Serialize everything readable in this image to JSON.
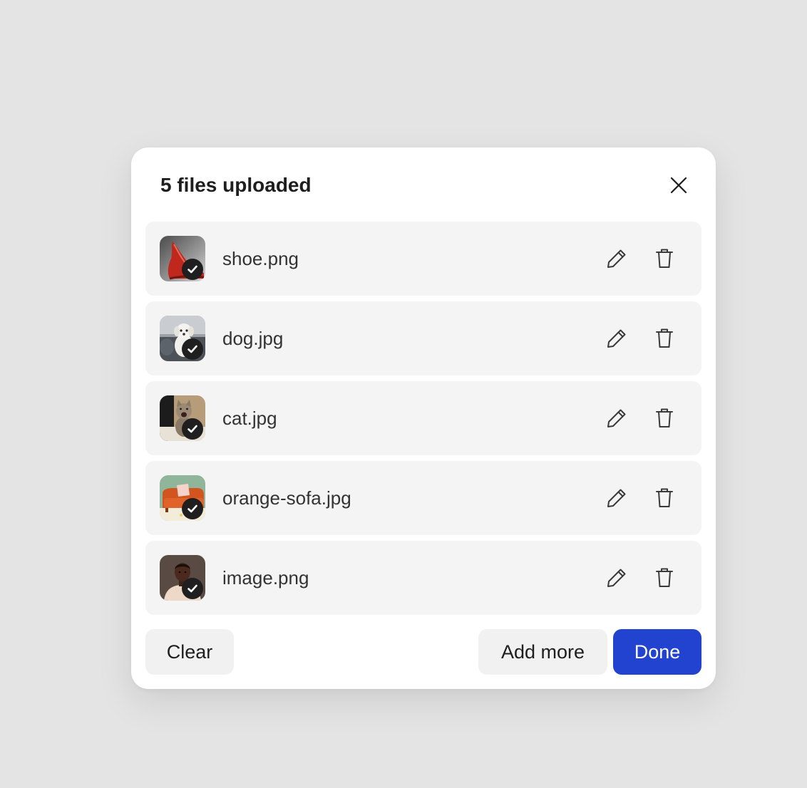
{
  "modal": {
    "title": "5 files uploaded",
    "close_icon": "close-icon"
  },
  "files": [
    {
      "name": "shoe.png",
      "thumbnail": "red-high-heel-shoe",
      "status": "uploaded"
    },
    {
      "name": "dog.jpg",
      "thumbnail": "white-dog-on-sofa",
      "status": "uploaded"
    },
    {
      "name": "cat.jpg",
      "thumbnail": "kitten-meowing",
      "status": "uploaded"
    },
    {
      "name": "orange-sofa.jpg",
      "thumbnail": "orange-sofa",
      "status": "uploaded"
    },
    {
      "name": "image.png",
      "thumbnail": "portrait-man",
      "status": "uploaded"
    }
  ],
  "row_icons": {
    "edit": "pencil-icon",
    "delete": "trash-icon",
    "status": "check-icon"
  },
  "footer": {
    "clear_label": "Clear",
    "add_more_label": "Add more",
    "done_label": "Done"
  },
  "colors": {
    "primary": "#2243d0",
    "background": "#e4e4e4",
    "row_background": "#f4f4f4"
  }
}
